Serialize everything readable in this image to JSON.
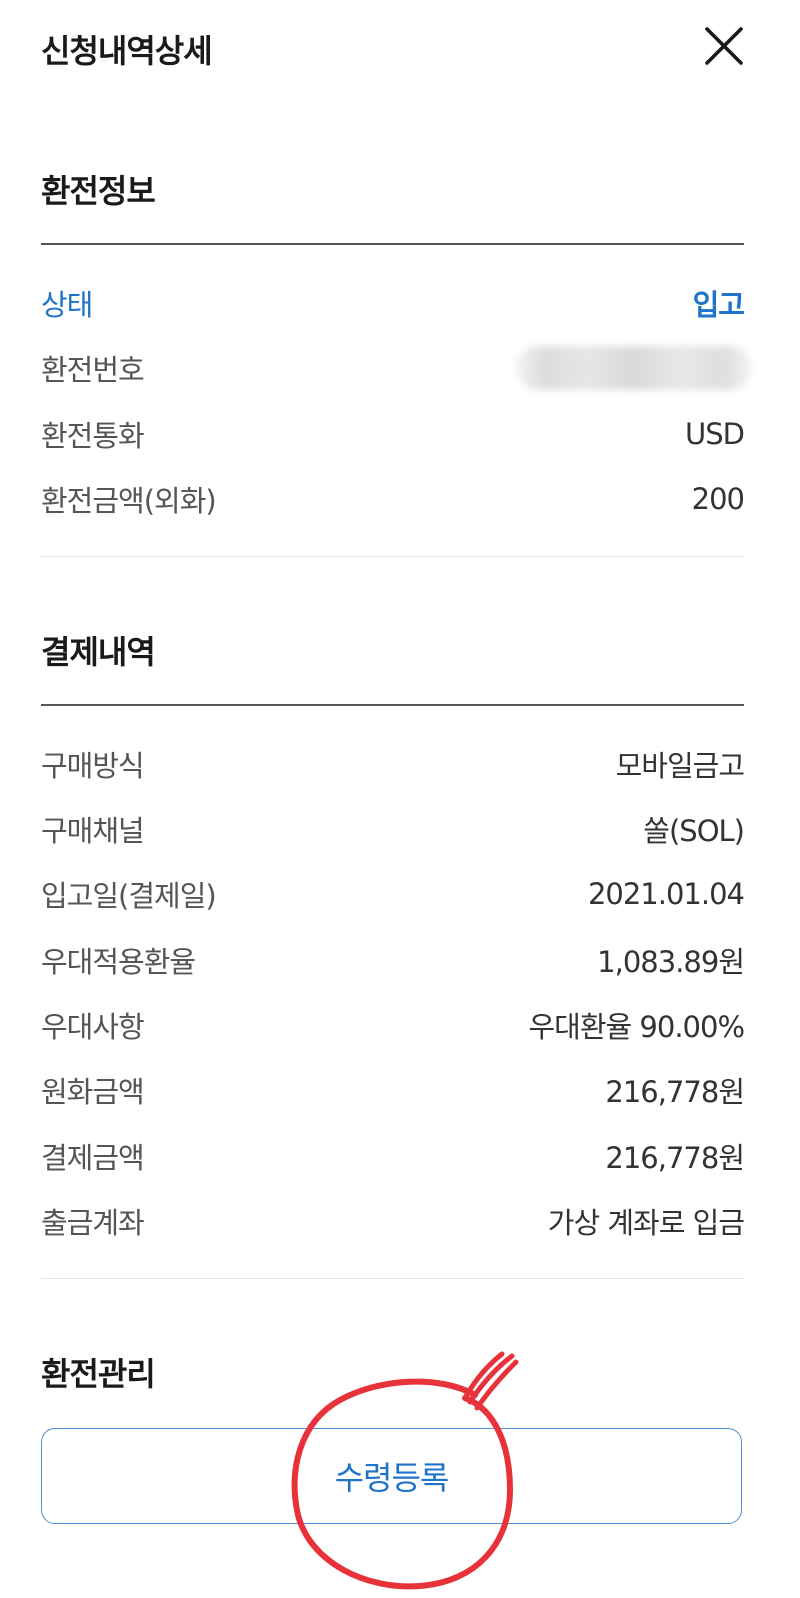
{
  "header": {
    "title": "신청내역상세",
    "close_icon": "close-icon"
  },
  "exchange_info": {
    "title": "환전정보",
    "rows": [
      {
        "label": "상태",
        "value": "입고"
      },
      {
        "label": "환전번호",
        "value": ""
      },
      {
        "label": "환전통화",
        "value": "USD"
      },
      {
        "label": "환전금액(외화)",
        "value": "200"
      }
    ],
    "accent_color": "#1f73c8"
  },
  "payment_details": {
    "title": "결제내역",
    "rows": [
      {
        "label": "구매방식",
        "value": "모바일금고"
      },
      {
        "label": "구매채널",
        "value": "쏠(SOL)"
      },
      {
        "label": "입고일(결제일)",
        "value": "2021.01.04"
      },
      {
        "label": "우대적용환율",
        "value": "1,083.89원"
      },
      {
        "label": "우대사항",
        "value": "우대환율 90.00%"
      },
      {
        "label": "원화금액",
        "value": "216,778원"
      },
      {
        "label": "결제금액",
        "value": "216,778원"
      },
      {
        "label": "출금계좌",
        "value": "가상 계좌로 입금"
      }
    ]
  },
  "exchange_management": {
    "title": "환전관리",
    "button_label": "수령등록"
  },
  "annotation": {
    "shape": "hand-drawn circle",
    "color": "#e8323a"
  }
}
